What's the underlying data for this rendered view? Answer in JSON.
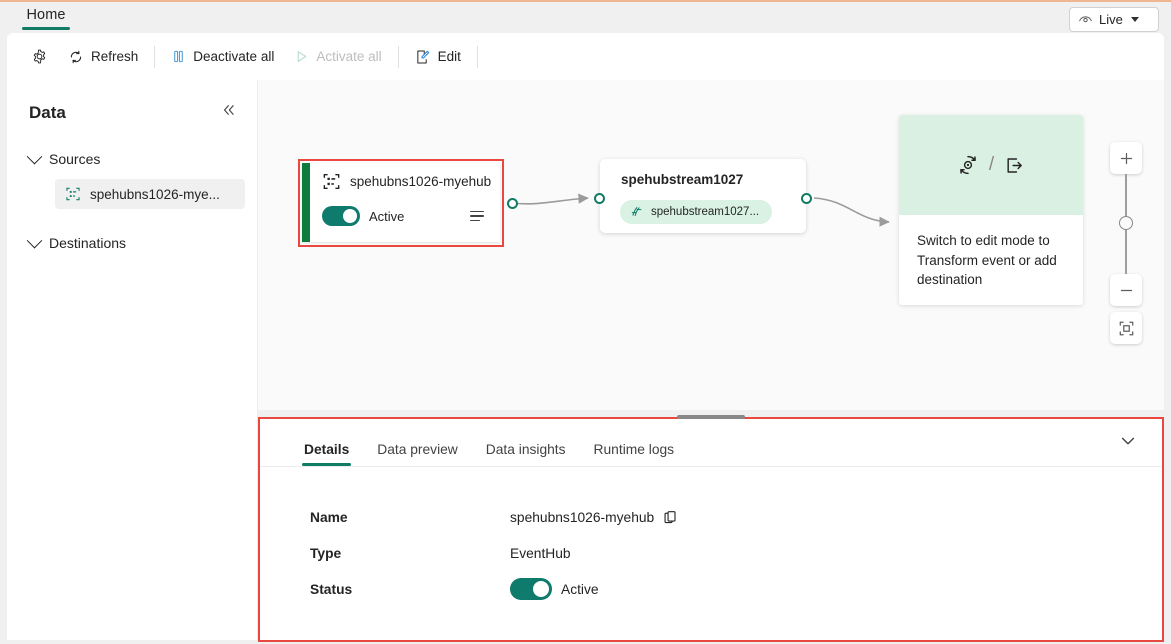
{
  "tabstrip": {
    "home_tab": "Home",
    "live_button": {
      "label": "Live",
      "icon": "eye-icon"
    }
  },
  "toolbar": {
    "settings_icon": "gear-icon",
    "refresh_label": "Refresh",
    "deactivate_all_label": "Deactivate all",
    "activate_all_label": "Activate all",
    "edit_label": "Edit"
  },
  "sidebar": {
    "title": "Data",
    "collapse_icon": "double-chevron-left-icon",
    "groups": [
      {
        "label": "Sources",
        "items": [
          {
            "label": "spehubns1026-mye...",
            "icon": "eventhub-icon"
          }
        ]
      },
      {
        "label": "Destinations",
        "items": []
      }
    ]
  },
  "canvas": {
    "source_node": {
      "title": "spehubns1026-myehub",
      "icon": "eventhub-icon",
      "status_label": "Active",
      "menu_icon": "hamburger-menu-icon"
    },
    "stream_node": {
      "title": "spehubstream1027",
      "pill_label": "spehubstream1027...",
      "pill_icon": "stream-icon"
    },
    "info_card": {
      "transform_icon": "transform-icon",
      "separator": "/",
      "destination_icon": "export-icon",
      "text": "Switch to edit mode to Transform event or add destination"
    },
    "zoom_controls": {
      "zoom_in_icon": "plus-icon",
      "zoom_out_icon": "minus-icon",
      "fit_icon": "fit-to-screen-icon"
    }
  },
  "details_panel": {
    "tabs": [
      {
        "label": "Details",
        "active": true
      },
      {
        "label": "Data preview",
        "active": false
      },
      {
        "label": "Data insights",
        "active": false
      },
      {
        "label": "Runtime logs",
        "active": false
      }
    ],
    "collapse_icon": "chevron-down-icon",
    "rows": [
      {
        "label": "Name",
        "value": "spehubns1026-myehub",
        "copy_icon": "copy-icon"
      },
      {
        "label": "Type",
        "value": "EventHub"
      },
      {
        "label": "Status",
        "value": "Active",
        "toggle": "on"
      }
    ]
  },
  "colors": {
    "accent_green": "#107c66",
    "node_bar_green": "#0e7a3c",
    "highlight_red": "#e8483f",
    "pill_green": "#d9f2e4",
    "card_green": "#d9f0e2",
    "toolbar_blue": "#4a9ad4"
  }
}
